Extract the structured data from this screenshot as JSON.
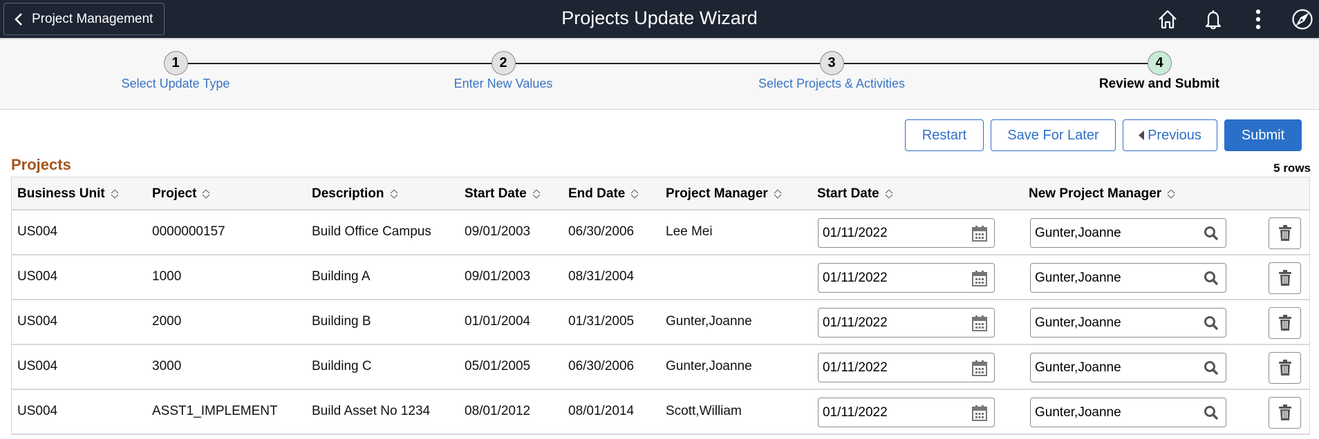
{
  "header": {
    "back_label": "Project Management",
    "title": "Projects Update Wizard",
    "icons": [
      "home-icon",
      "bell-icon",
      "more-vertical-icon",
      "compass-icon"
    ]
  },
  "wizard": {
    "steps": [
      {
        "number": "1",
        "label": "Select Update Type",
        "state": "visited"
      },
      {
        "number": "2",
        "label": "Enter New Values",
        "state": "visited"
      },
      {
        "number": "3",
        "label": "Select Projects & Activities",
        "state": "visited"
      },
      {
        "number": "4",
        "label": "Review and Submit",
        "state": "current"
      }
    ]
  },
  "toolbar": {
    "restart_label": "Restart",
    "save_label": "Save For Later",
    "previous_label": "Previous",
    "submit_label": "Submit"
  },
  "colors": {
    "header_bg": "#1d2533",
    "accent_blue": "#2a6fc9",
    "section_title": "#a4551c",
    "current_step": "#c9ebd7"
  },
  "projects": {
    "title": "Projects",
    "row_count": "5 rows",
    "columns": [
      "Business Unit",
      "Project",
      "Description",
      "Start Date",
      "End Date",
      "Project Manager",
      "Start Date",
      "New Project Manager"
    ],
    "rows": [
      {
        "business_unit": "US004",
        "project": "0000000157",
        "description": "Build Office Campus",
        "start_date": "09/01/2003",
        "end_date": "06/30/2006",
        "project_manager": "Lee Mei",
        "new_start_date": "01/11/2022",
        "new_project_manager": "Gunter,Joanne"
      },
      {
        "business_unit": "US004",
        "project": "1000",
        "description": "Building A",
        "start_date": "09/01/2003",
        "end_date": "08/31/2004",
        "project_manager": "",
        "new_start_date": "01/11/2022",
        "new_project_manager": "Gunter,Joanne"
      },
      {
        "business_unit": "US004",
        "project": "2000",
        "description": "Building B",
        "start_date": "01/01/2004",
        "end_date": "01/31/2005",
        "project_manager": "Gunter,Joanne",
        "new_start_date": "01/11/2022",
        "new_project_manager": "Gunter,Joanne"
      },
      {
        "business_unit": "US004",
        "project": "3000",
        "description": "Building C",
        "start_date": "05/01/2005",
        "end_date": "06/30/2006",
        "project_manager": "Gunter,Joanne",
        "new_start_date": "01/11/2022",
        "new_project_manager": "Gunter,Joanne"
      },
      {
        "business_unit": "US004",
        "project": "ASST1_IMPLEMENT",
        "description": "Build Asset No 1234",
        "start_date": "08/01/2012",
        "end_date": "08/01/2014",
        "project_manager": "Scott,William",
        "new_start_date": "01/11/2022",
        "new_project_manager": "Gunter,Joanne"
      }
    ]
  }
}
